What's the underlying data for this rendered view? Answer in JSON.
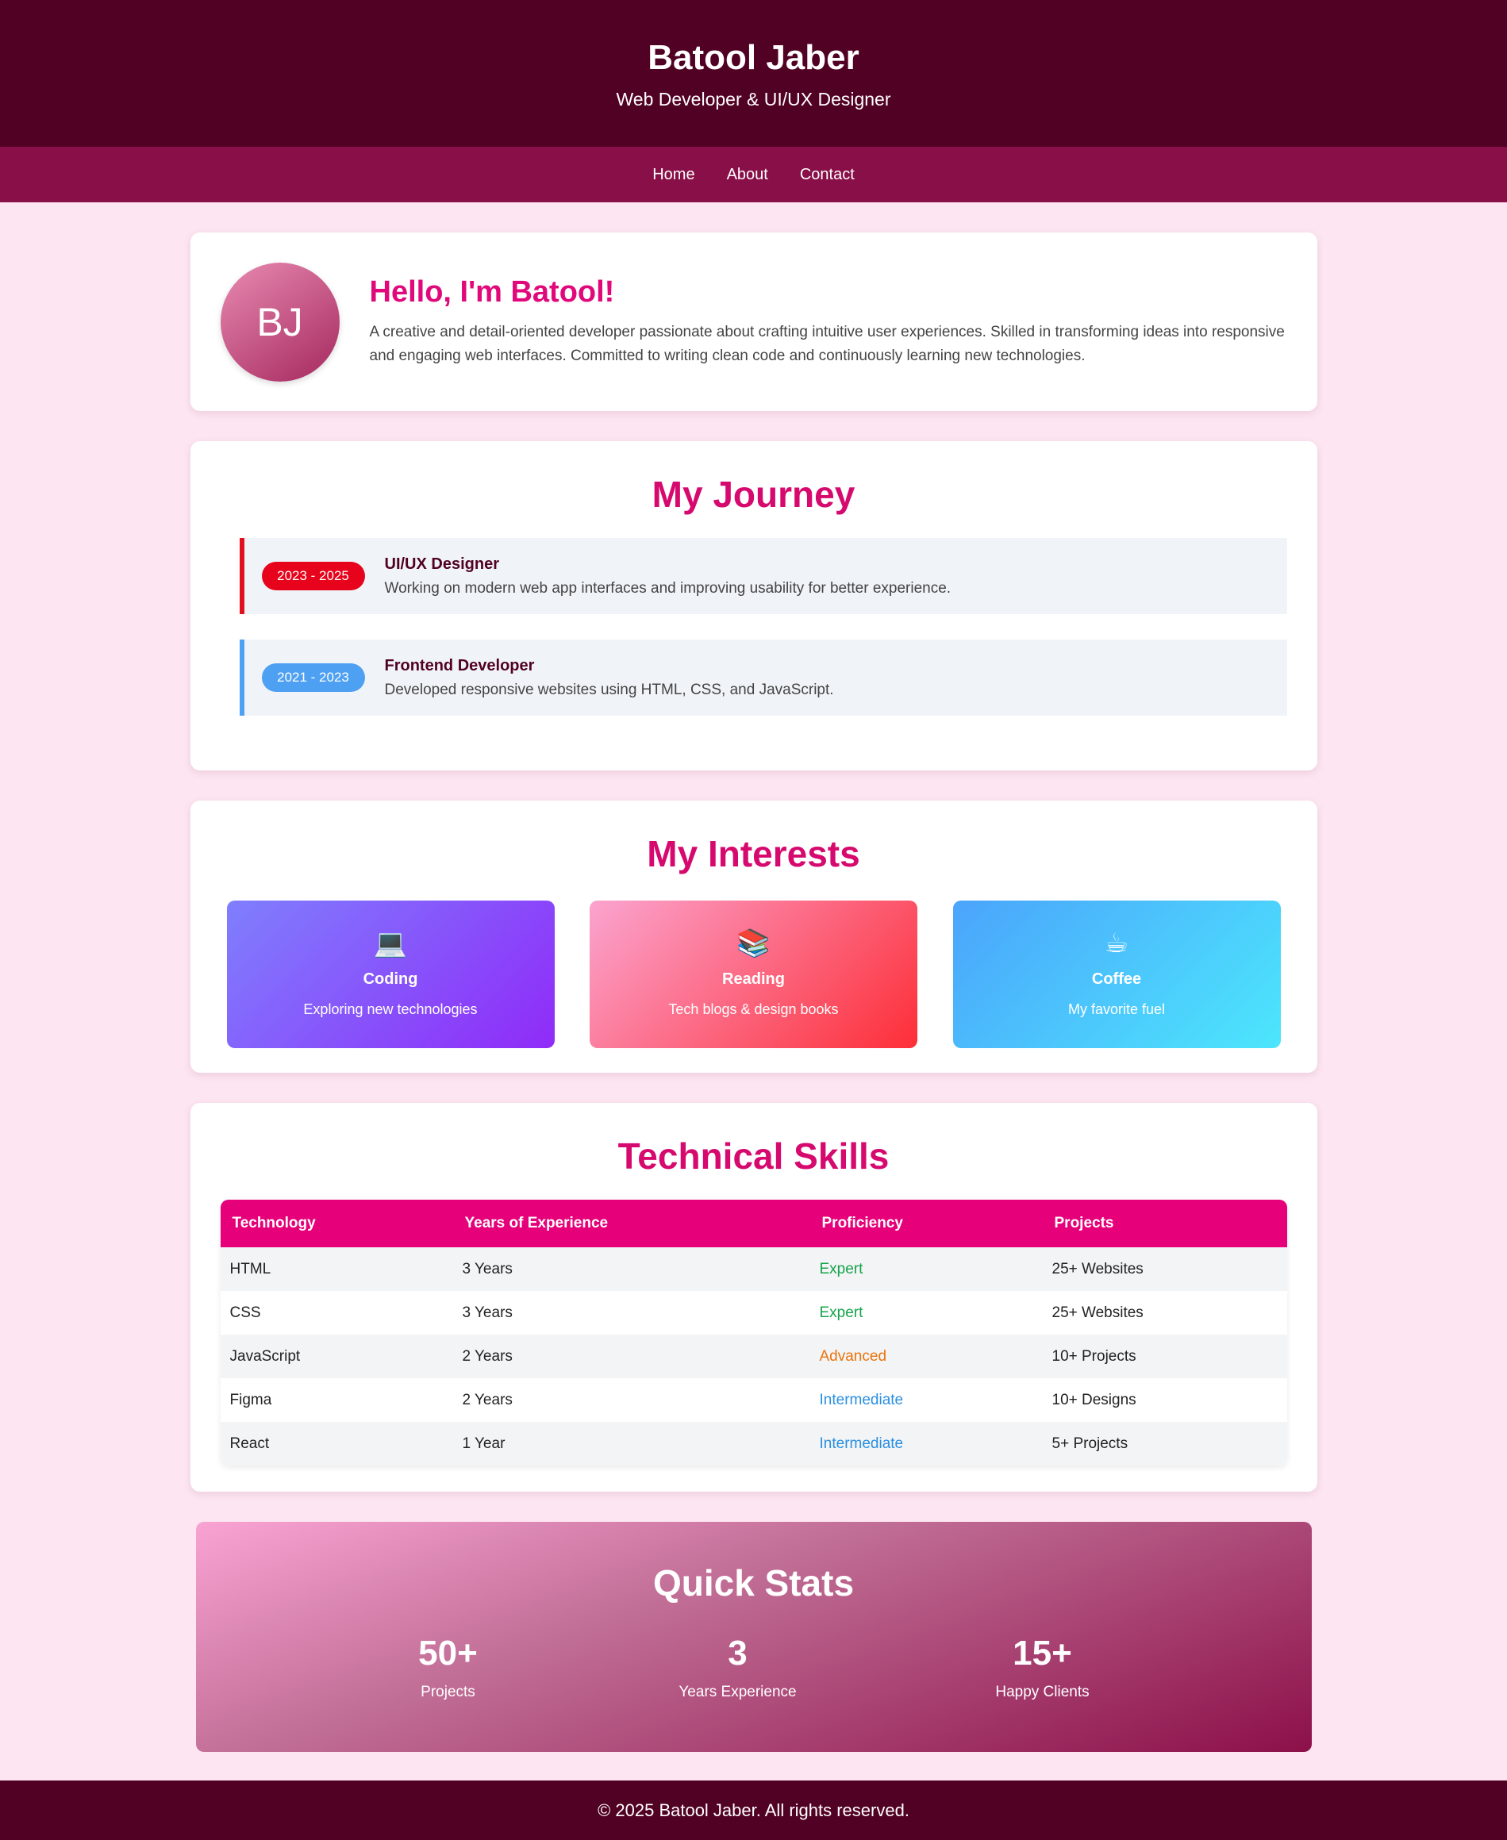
{
  "header": {
    "name": "Batool Jaber",
    "tagline": "Web Developer & UI/UX Designer"
  },
  "nav": {
    "items": [
      "Home",
      "About",
      "Contact"
    ]
  },
  "about": {
    "avatar_initials": "BJ",
    "greeting": "Hello, I'm Batool!",
    "bio": "A creative and detail-oriented developer passionate about crafting intuitive user experiences. Skilled in transforming ideas into responsive and engaging web interfaces. Committed to writing clean code and continuously learning new technologies."
  },
  "journey": {
    "title": "My Journey",
    "items": [
      {
        "period": "2023 - 2025",
        "role": "UI/UX Designer",
        "description": "Working on modern web app interfaces and improving usability for better experience.",
        "accent": "#e0101e"
      },
      {
        "period": "2021 - 2023",
        "role": "Frontend Developer",
        "description": "Developed responsive websites using HTML, CSS, and JavaScript.",
        "accent": "#4ea0f2"
      }
    ]
  },
  "interests": {
    "title": "My Interests",
    "items": [
      {
        "icon": "laptop-icon",
        "glyph": "💻",
        "title": "Coding",
        "subtitle": "Exploring new technologies"
      },
      {
        "icon": "books-icon",
        "glyph": "📚",
        "title": "Reading",
        "subtitle": "Tech blogs & design books"
      },
      {
        "icon": "coffee-icon",
        "glyph": "☕",
        "title": "Coffee",
        "subtitle": "My favorite fuel"
      }
    ]
  },
  "skills": {
    "title": "Technical Skills",
    "columns": [
      "Technology",
      "Years of Experience",
      "Proficiency",
      "Projects"
    ],
    "rows": [
      [
        "HTML",
        "3 Years",
        "Expert",
        "25+ Websites"
      ],
      [
        "CSS",
        "3 Years",
        "Expert",
        "25+ Websites"
      ],
      [
        "JavaScript",
        "2 Years",
        "Advanced",
        "10+ Projects"
      ],
      [
        "Figma",
        "2 Years",
        "Intermediate",
        "10+ Designs"
      ],
      [
        "React",
        "1 Year",
        "Intermediate",
        "5+ Projects"
      ]
    ],
    "colors": {
      "header": "#e6007a",
      "expert": "#16a34a",
      "advanced": "#ea740c",
      "intermediate": "#2a8fe0"
    }
  },
  "stats": {
    "title": "Quick Stats",
    "items": [
      {
        "value": "50+",
        "label": "Projects"
      },
      {
        "value": "3",
        "label": "Years Experience"
      },
      {
        "value": "15+",
        "label": "Happy Clients"
      }
    ]
  },
  "footer": {
    "copyright": "© 2025 Batool Jaber. All rights reserved."
  },
  "theme": {
    "primary_dark": "#510123",
    "nav_bg": "#880f47",
    "accent": "#e0087a",
    "page_bg": "#fde6f1"
  }
}
